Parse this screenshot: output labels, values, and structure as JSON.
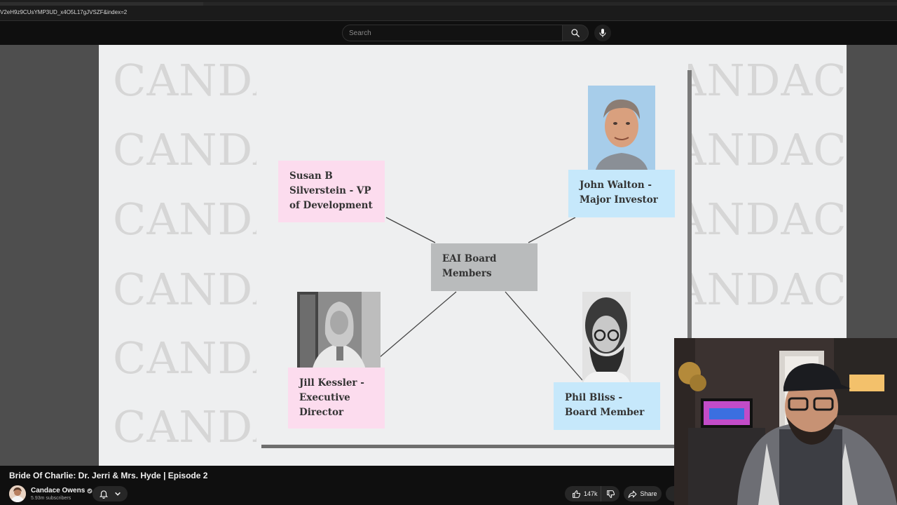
{
  "browser": {
    "url_fragment": "V2eH9z9CUsYMP3UD_x4O5L17gJVSZF&index=2"
  },
  "masthead": {
    "search_placeholder": "Search"
  },
  "slide": {
    "watermark_text": "CANDACE",
    "center_node": "EAI Board Members",
    "nodes": {
      "susan": "Susan B Silverstein - VP of Development",
      "john": "John Walton - Major Investor",
      "jill": "Jill Kessler - Executive Director",
      "phil": "Phil Bliss - Board Member"
    }
  },
  "video": {
    "title": "Bride Of Charlie: Dr. Jerri & Mrs. Hyde | Episode 2",
    "channel": "Candace Owens",
    "subscribers": "5.93m subscribers",
    "likes": "147k",
    "share_label": "Share"
  },
  "colors": {
    "note_pink": "#fcdcee",
    "note_blue": "#c6e8fb",
    "center_gray": "#b9bbbc",
    "page_bg": "#0f0f0f"
  },
  "icons": [
    "search-icon",
    "mic-icon",
    "bell-icon",
    "chevron-down-icon",
    "thumbs-up-icon",
    "thumbs-down-icon",
    "share-icon",
    "verified-icon"
  ]
}
